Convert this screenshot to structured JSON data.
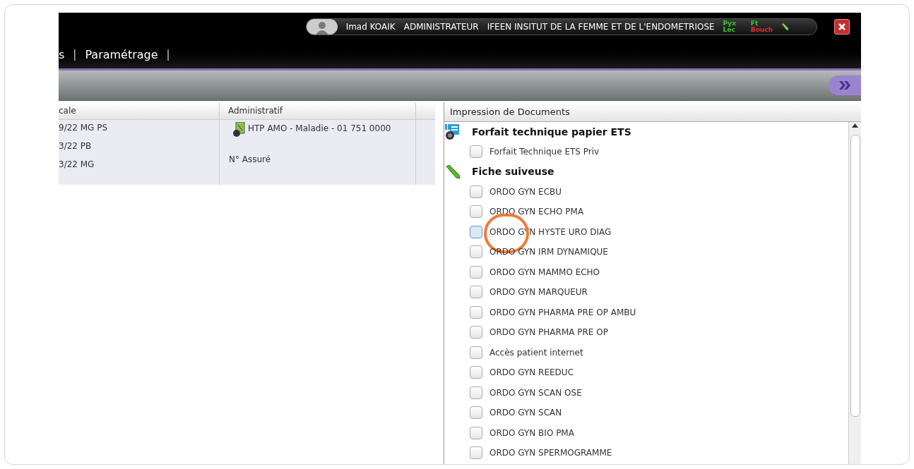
{
  "top_bar": {
    "user": "Imad KOAIK",
    "role": "ADMINISTRATEUR",
    "establishment": "IFEEN INSITUT DE LA FEMME ET DE L'ENDOMETRIOSE",
    "status_codes": [
      {
        "text": "Pyx",
        "color": "#33cc33"
      },
      {
        "text": "Lec",
        "color": "#33cc33"
      },
      {
        "text": "Ft",
        "color": "#33cc33"
      },
      {
        "text": "Bouch",
        "color": "#e03030"
      }
    ]
  },
  "nav": {
    "items": [
      {
        "kind": "link",
        "text": "s"
      },
      {
        "kind": "separator",
        "text": "|"
      },
      {
        "kind": "link",
        "text": "Paramétrage"
      },
      {
        "kind": "separator",
        "text": "|"
      }
    ]
  },
  "table": {
    "columns": [
      "cale",
      "Administratif"
    ],
    "column_1_lines": [
      "9/22 MG PS",
      "3/22 PB",
      "3/22 MG"
    ],
    "administratif": {
      "insurance": "HTP AMO - Maladie - 01 751 0000",
      "insured_number_label": "N° Assuré"
    }
  },
  "documents": {
    "title": "Impression de Documents",
    "groups": [
      {
        "kind": "forfait",
        "title": "Forfait technique papier ETS",
        "items": [
          {
            "label": "Forfait Technique ETS Priv",
            "checked": false,
            "highlighted": false
          }
        ]
      },
      {
        "kind": "fiche",
        "title": "Fiche suiveuse",
        "items": [
          {
            "label": "ORDO GYN ECBU",
            "checked": false,
            "highlighted": false
          },
          {
            "label": "ORDO GYN ECHO PMA",
            "checked": false,
            "highlighted": false
          },
          {
            "label": "ORDO GYN HYSTE URO DIAG",
            "checked": false,
            "highlighted": true
          },
          {
            "label": "ORDO GYN IRM DYNAMIQUE",
            "checked": false,
            "highlighted": false
          },
          {
            "label": "ORDO GYN MAMMO ECHO",
            "checked": false,
            "highlighted": false
          },
          {
            "label": "ORDO GYN MARQUEUR",
            "checked": false,
            "highlighted": false
          },
          {
            "label": "ORDO GYN PHARMA PRE OP AMBU",
            "checked": false,
            "highlighted": false
          },
          {
            "label": "ORDO GYN PHARMA PRE OP",
            "checked": false,
            "highlighted": false
          },
          {
            "label": "Accès patient internet",
            "checked": false,
            "highlighted": false
          },
          {
            "label": "ORDO GYN REEDUC",
            "checked": false,
            "highlighted": false
          },
          {
            "label": "ORDO GYN SCAN OSE",
            "checked": false,
            "highlighted": false
          },
          {
            "label": "ORDO GYN SCAN",
            "checked": false,
            "highlighted": false
          },
          {
            "label": "ORDO GYN BIO PMA",
            "checked": false,
            "highlighted": false
          },
          {
            "label": "ORDO GYN SPERMOGRAMME",
            "checked": false,
            "highlighted": false
          }
        ]
      }
    ]
  }
}
